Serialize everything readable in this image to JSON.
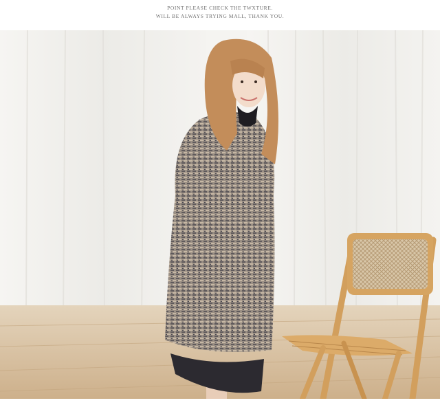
{
  "notice": {
    "line1": "POINT PLEASE CHECK THE TWXTURE.",
    "line2": "WILL BE ALWAYS TRYING MALL, THANK YOU."
  },
  "photo": {
    "subject": "model in oversized knit sweater dress beside a wooden rattan chair",
    "colors": {
      "wall": "#f6f5f3",
      "curtain": "#efeeea",
      "floor": "#d6c09f",
      "sweater": "#8d8276",
      "hair": "#c48e5c",
      "chair_wood": "#d6a461",
      "rattan": "#c8b394"
    }
  }
}
